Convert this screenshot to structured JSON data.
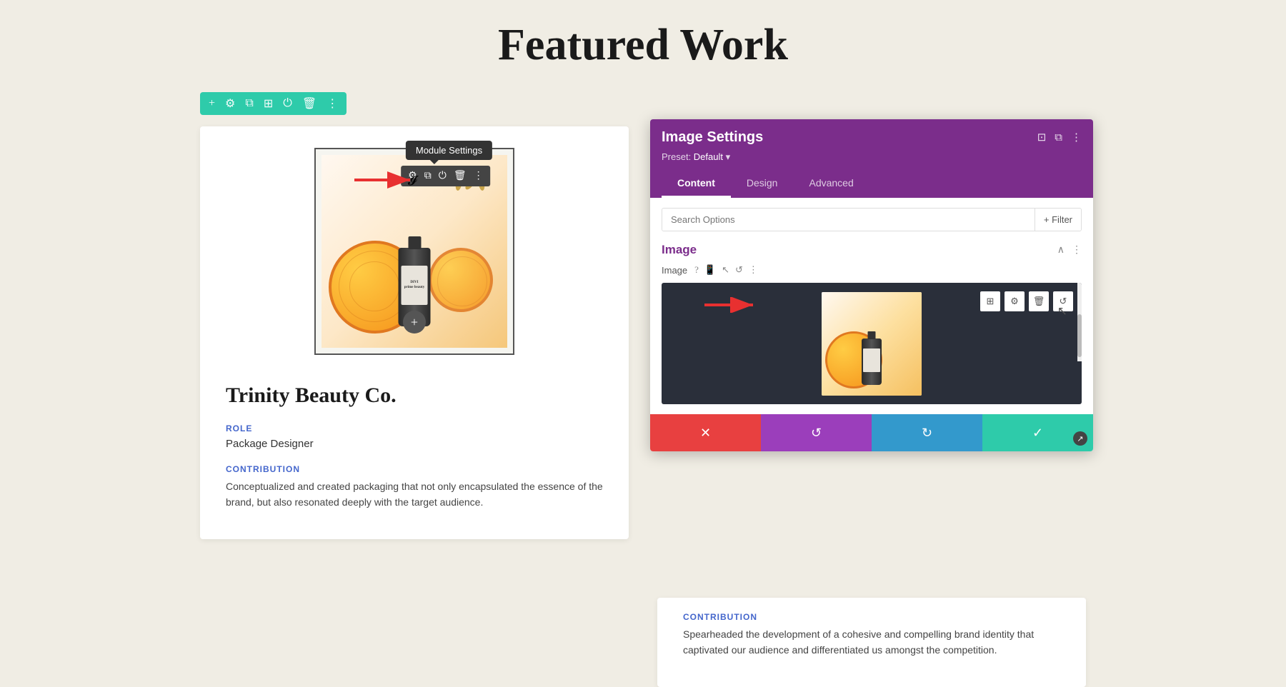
{
  "page": {
    "title": "Featured Work",
    "background": "#f0ede4"
  },
  "toolbar": {
    "buttons": [
      "+",
      "⚙",
      "⧉",
      "⊞",
      "⏻",
      "🗑",
      "⋮"
    ]
  },
  "card_left": {
    "title": "Trinity Beauty Co.",
    "role_label": "ROLE",
    "role_value": "Package Designer",
    "contribution_label": "CONTRIBUTION",
    "contribution_text": "Conceptualized and created packaging that not only encapsulated the essence of the brand, but also resonated deeply with the target audience.",
    "module_settings_tooltip": "Module Settings"
  },
  "card_right": {
    "contribution_label": "CONTRIBUTION",
    "contribution_text": "Spearheaded the development of a cohesive and compelling brand identity that captivated our audience and differentiated us amongst the competition."
  },
  "settings_panel": {
    "title": "Image Settings",
    "preset_label": "Preset:",
    "preset_value": "Default",
    "tabs": [
      "Content",
      "Design",
      "Advanced"
    ],
    "active_tab": "Content",
    "search_placeholder": "Search Options",
    "filter_button": "+ Filter",
    "section_name": "Image",
    "image_field_label": "Image",
    "action_buttons": {
      "cancel": "✕",
      "undo": "↺",
      "redo": "↻",
      "confirm": "✓"
    }
  }
}
